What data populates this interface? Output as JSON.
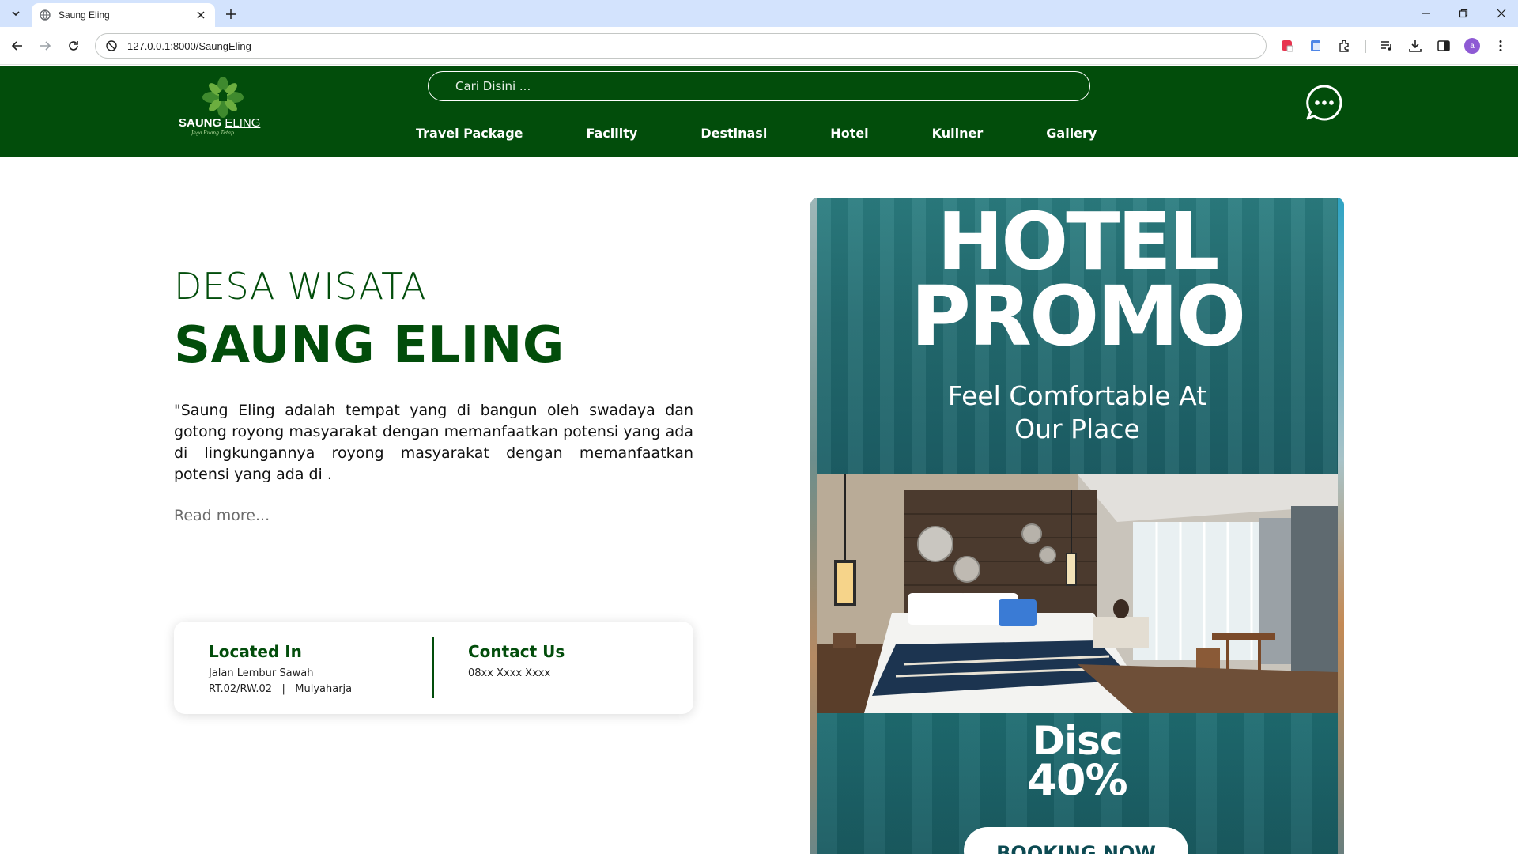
{
  "browser": {
    "tab_title": "Saung Eling",
    "url": "127.0.0.1:8000/SaungEling",
    "profile_initial": "a"
  },
  "site": {
    "logo": {
      "name": "SAUNG",
      "name2": "ELING",
      "tagline": "Jaga Ruang Tetap"
    },
    "search_placeholder": "Cari Disini ...",
    "nav": [
      "Travel Package",
      "Facility",
      "Destinasi",
      "Hotel",
      "Kuliner",
      "Gallery"
    ],
    "brand_color": "#024d0b"
  },
  "hero": {
    "eyebrow": "DESA WISATA",
    "title": "SAUNG ELING",
    "description": "\"Saung Eling adalah tempat yang di bangun oleh swadaya dan gotong royong masyarakat dengan memanfaatkan potensi yang ada di lingkungannya royong masyarakat dengan memanfaatkan potensi yang ada di .",
    "read_more": "Read more..."
  },
  "info": {
    "location": {
      "title": "Located In",
      "line1": "Jalan Lembur Sawah",
      "line2": "RT.02/RW.02   |   Mulyaharja"
    },
    "contact": {
      "title": "Contact Us",
      "phone": "08xx Xxxx Xxxx"
    }
  },
  "promo": {
    "line1": "HOTEL",
    "line2": "PROMO",
    "subtitle": "Feel Comfortable At Our Place",
    "disc_label": "Disc",
    "disc_value": "40%",
    "cta": "BOOKING NOW",
    "accent": "#1e6b70"
  }
}
